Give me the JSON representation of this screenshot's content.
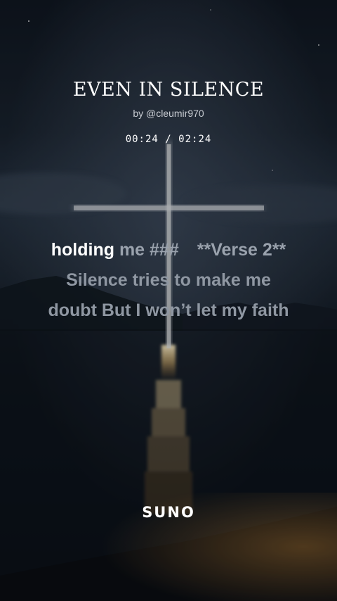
{
  "song": {
    "title": "EVEN IN SILENCE",
    "artist": "by @cleumir970"
  },
  "player": {
    "current_time": "00:24",
    "separator": "/",
    "total_time": "02:24"
  },
  "lyrics": {
    "line1": {
      "active": "holding",
      "rest": "me ###",
      "tag": "**Verse 2**"
    },
    "line2": "Silence tries to make me",
    "line3": "doubt But I won’t let my faith"
  },
  "brand": {
    "logo_text": "SUNO"
  },
  "colors": {
    "active_lyric": "#ffffff",
    "inactive_lyric": "#9aa2ad",
    "glow": "#ffd58a"
  }
}
